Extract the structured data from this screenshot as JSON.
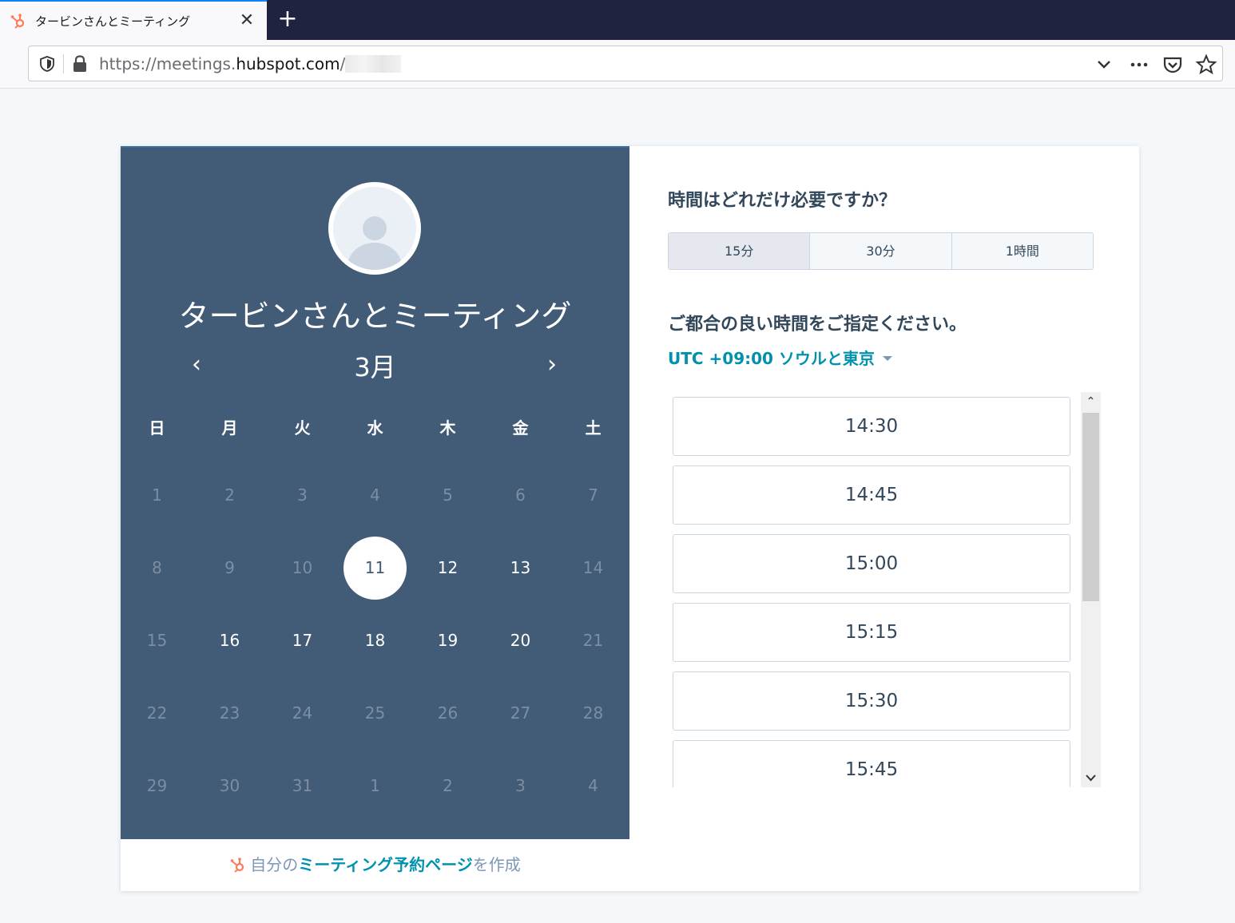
{
  "browser": {
    "tab_title": "タービンさんとミーティング",
    "tab_close": "✕",
    "new_tab": "+",
    "url_prefix": "https://meetings.",
    "url_host": "hubspot.com",
    "url_suffix": "/"
  },
  "calendar": {
    "meeting_title": "タービンさんとミーティング",
    "month": "3月",
    "prev": "‹",
    "next": "›",
    "weekdays": [
      "日",
      "月",
      "火",
      "水",
      "木",
      "金",
      "土"
    ],
    "days": [
      [
        "1",
        "2",
        "3",
        "4",
        "5",
        "6",
        "7"
      ],
      [
        "8",
        "9",
        "10",
        "11",
        "12",
        "13",
        "14"
      ],
      [
        "15",
        "16",
        "17",
        "18",
        "19",
        "20",
        "21"
      ],
      [
        "22",
        "23",
        "24",
        "25",
        "26",
        "27",
        "28"
      ],
      [
        "29",
        "30",
        "31",
        "1",
        "2",
        "3",
        "4"
      ]
    ],
    "selected_day": "11",
    "available_days": [
      "12",
      "13",
      "16",
      "17",
      "18",
      "19",
      "20"
    ]
  },
  "footer": {
    "prefix": "自分の",
    "link": "ミーティング予約ページ",
    "suffix": "を作成"
  },
  "scheduler": {
    "duration_question": "時間はどれだけ必要ですか？",
    "durations": [
      "15分",
      "30分",
      "1時間"
    ],
    "selected_duration": "15分",
    "time_question": "ご都合の良い時間をご指定ください。",
    "timezone": "UTC +09:00 ソウルと東京",
    "slots": [
      "14:30",
      "14:45",
      "15:00",
      "15:15",
      "15:30",
      "15:45"
    ]
  },
  "colors": {
    "calendar_bg": "#425b76",
    "accent": "#0091ae",
    "hubspot_orange": "#ff7a59"
  }
}
